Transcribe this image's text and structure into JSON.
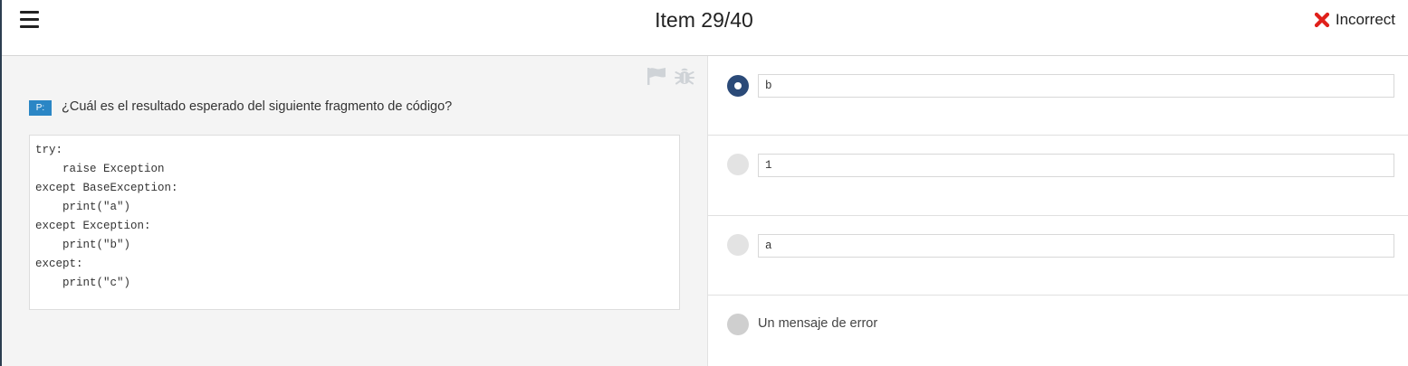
{
  "header": {
    "title": "Item 29/40",
    "status_label": "Incorrect",
    "status_color": "#e0201b"
  },
  "question": {
    "badge": "P:",
    "text": "¿Cuál es el resultado esperado del siguiente fragmento de código?",
    "code": "try:\n    raise Exception\nexcept BaseException:\n    print(\"a\")\nexcept Exception:\n    print(\"b\")\nexcept:\n    print(\"c\")"
  },
  "answers": [
    {
      "label": "b",
      "selected": true
    },
    {
      "label": "1",
      "selected": false
    },
    {
      "label": "a",
      "selected": false
    },
    {
      "label": "Un mensaje de error",
      "selected": false
    }
  ],
  "icons": {
    "menu": "hamburger-menu-icon",
    "status": "x-cross-icon",
    "flag": "flag-icon",
    "report": "bug-icon"
  }
}
